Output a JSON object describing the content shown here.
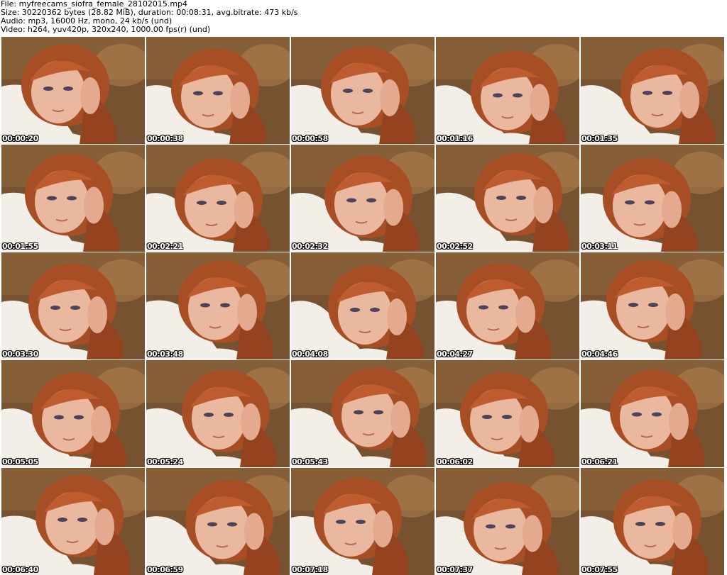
{
  "header": {
    "file_line": "File: myfreecams_siofra_female_28102015.mp4",
    "size_line": "Size: 30220362 bytes (28.82 MiB), duration: 00:08:31, avg.bitrate: 473 kb/s",
    "audio_line": "Audio: mp3, 16000 Hz, mono, 24 kb/s (und)",
    "video_line": "Video: h264, yuv420p, 320x240, 1000.00 fps(r) (und)"
  },
  "thumbnails": [
    {
      "timestamp": "00:00:20"
    },
    {
      "timestamp": "00:00:38"
    },
    {
      "timestamp": "00:00:58"
    },
    {
      "timestamp": "00:01:16"
    },
    {
      "timestamp": "00:01:35"
    },
    {
      "timestamp": "00:01:55"
    },
    {
      "timestamp": "00:02:21"
    },
    {
      "timestamp": "00:02:32"
    },
    {
      "timestamp": "00:02:52"
    },
    {
      "timestamp": "00:03:11"
    },
    {
      "timestamp": "00:03:30"
    },
    {
      "timestamp": "00:03:48"
    },
    {
      "timestamp": "00:04:08"
    },
    {
      "timestamp": "00:04:27"
    },
    {
      "timestamp": "00:04:46"
    },
    {
      "timestamp": "00:05:05"
    },
    {
      "timestamp": "00:05:24"
    },
    {
      "timestamp": "00:05:43"
    },
    {
      "timestamp": "00:06:02"
    },
    {
      "timestamp": "00:06:21"
    },
    {
      "timestamp": "00:06:40"
    },
    {
      "timestamp": "00:06:59"
    },
    {
      "timestamp": "00:07:18"
    },
    {
      "timestamp": "00:07:37"
    },
    {
      "timestamp": "00:07:55"
    }
  ],
  "colors": {
    "background": "#ffffff",
    "header_text": "#000000",
    "timestamp_text": "#ffffff",
    "timestamp_outline": "#000000",
    "hair": "#a0461e",
    "skin": "#e8b9a3",
    "shirt": "#f4f4f2",
    "backdrop": "#6b4a2c"
  }
}
